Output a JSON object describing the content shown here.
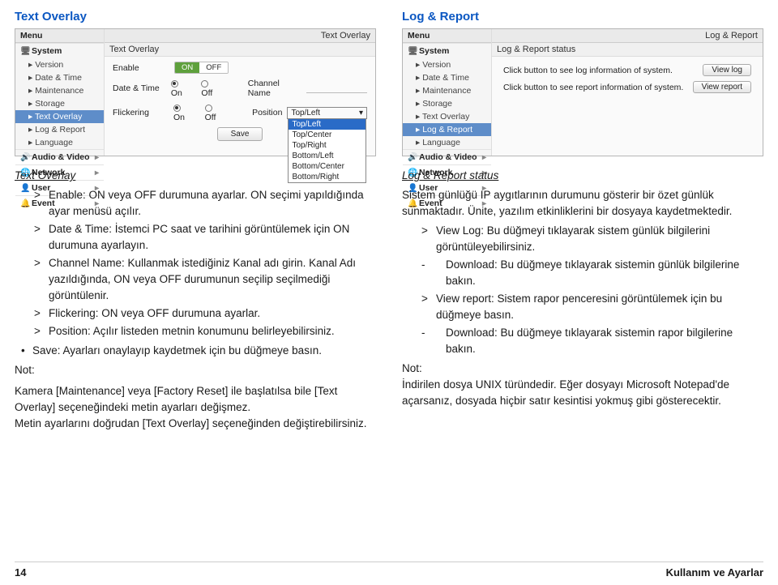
{
  "left": {
    "section_title": "Text Overlay",
    "shot": {
      "menu_label": "Menu",
      "crumb": "Text Overlay",
      "pane_label": "Text Overlay",
      "sidebar": {
        "groups": [
          {
            "label": "System",
            "items": [
              "Version",
              "Date & Time",
              "Maintenance",
              "Storage",
              "Text Overlay",
              "Log & Report",
              "Language"
            ],
            "active_index": 4
          },
          {
            "label": "Audio & Video"
          },
          {
            "label": "Network"
          },
          {
            "label": "User"
          },
          {
            "label": "Event"
          }
        ]
      },
      "form": {
        "enable_label": "Enable",
        "enable_on": "ON",
        "enable_off": "OFF",
        "date_time_label": "Date & Time",
        "channel_name_label": "Channel Name",
        "on_label": "On",
        "off_label": "Off",
        "flickering_label": "Flickering",
        "position_label": "Position",
        "position_selected": "Top/Left",
        "positions": [
          "Top/Left",
          "Top/Center",
          "Top/Right",
          "Bottom/Left",
          "Bottom/Center",
          "Bottom/Right"
        ],
        "save_label": "Save"
      }
    },
    "overlay_heading": "Text Overlay",
    "bullets": [
      "Enable: ON veya OFF durumuna ayarlar. ON seçimi yapıldığında ayar menüsü açılır.",
      "Date & Time: İstemci PC saat ve tarihini görüntülemek için ON durumuna ayarlayın.",
      "Channel Name: Kullanmak istediğiniz Kanal adı girin. Kanal Adı yazıldığında, ON veya OFF durumunun seçilip seçilmediği görüntülenir.",
      "Flickering: ON veya OFF durumuna ayarlar.",
      "Position: Açılır listeden metnin konumunu belirleyebilirsiniz."
    ],
    "save_bullet": "Save: Ayarları onaylayıp kaydetmek için bu düğmeye basın.",
    "note_label": "Not:",
    "note1": "Kamera [Maintenance] veya [Factory Reset] ile başlatılsa bile [Text Overlay] seçeneğindeki metin ayarları değişmez.",
    "note2": "Metin ayarlarını doğrudan [Text Overlay] seçeneğinden değiştirebilirsiniz."
  },
  "right": {
    "section_title": "Log & Report",
    "shot": {
      "menu_label": "Menu",
      "crumb": "Log & Report",
      "pane_label": "Log & Report status",
      "sidebar": {
        "groups": [
          {
            "label": "System",
            "items": [
              "Version",
              "Date & Time",
              "Maintenance",
              "Storage",
              "Text Overlay",
              "Log & Report",
              "Language"
            ],
            "active_index": 5
          },
          {
            "label": "Audio & Video"
          },
          {
            "label": "Network"
          },
          {
            "label": "User"
          },
          {
            "label": "Event"
          }
        ]
      },
      "lines": [
        {
          "text": "Click button to see log information of system.",
          "button": "View log"
        },
        {
          "text": "Click button to see report information of system.",
          "button": "View report"
        }
      ]
    },
    "status_heading": "Log & Report status",
    "intro": "Sistem günlüğü IP aygıtlarının durumunu gösterir bir özet günlük sunmaktadır. Ünite, yazılım etkinliklerini bir dosyaya kaydetmektedir.",
    "bullets": [
      {
        "type": "chev",
        "text": "View Log: Bu düğmeyi tıklayarak sistem günlük bilgilerini görüntüleyebilirsiniz."
      },
      {
        "type": "dash",
        "text": "Download: Bu düğmeye tıklayarak sistemin günlük bilgilerine bakın."
      },
      {
        "type": "chev",
        "text": "View report: Sistem rapor penceresini görüntülemek için bu düğmeye basın."
      },
      {
        "type": "dash",
        "text": "Download: Bu düğmeye tıklayarak sistemin rapor bilgilerine bakın."
      }
    ],
    "note_label": "Not:",
    "note": "İndirilen dosya UNIX türündedir. Eğer dosyayı Microsoft Notepad'de açarsanız, dosyada hiçbir satır kesintisi yokmuş gibi gösterecektir."
  },
  "footer": {
    "page": "14",
    "label": "Kullanım ve Ayarlar"
  }
}
